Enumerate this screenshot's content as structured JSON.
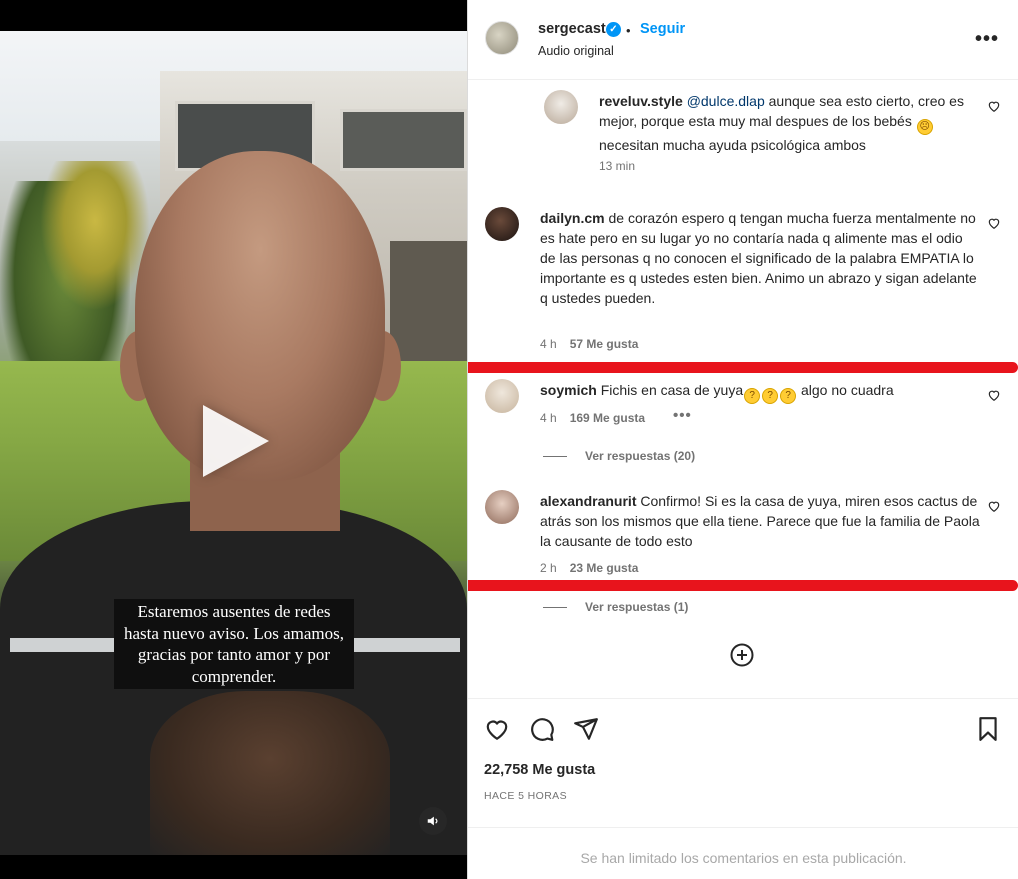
{
  "video": {
    "caption": "Estaremos ausentes de redes hasta nuevo aviso. Los amamos, gracias por tanto amor y por comprender.",
    "play_icon": "play-icon",
    "mute_icon": "speaker-icon"
  },
  "header": {
    "username": "sergecast",
    "verified_icon": "verified-badge-icon",
    "separator": "•",
    "follow_label": "Seguir",
    "subtitle": "Audio original",
    "more_icon": "more-options-icon"
  },
  "comments": [
    {
      "username": "reveluv.style",
      "mention": "@dulce.dlap",
      "text": " aunque sea esto cierto, creo es mejor, porque esta muy mal despues de los bebés",
      "text_emoji": "😦",
      "text_tail": " necesitan mucha ayuda psicológica ambos",
      "time": "13 min"
    },
    {
      "username": "dailyn.cm",
      "text": "de corazón espero q tengan mucha fuerza mentalmente no es hate pero en su lugar yo no contaría nada q alimente mas el odio de las personas q no conocen el significado de la palabra EMPATIA lo importante es q ustedes esten bien. Animo un abrazo y sigan adelante q ustedes pueden.",
      "time": "4 h",
      "likes": "57 Me gusta"
    },
    {
      "username": "soymich",
      "text": "Fichis en casa de yuya",
      "emojis": "🤔🤔🤔",
      "text_tail": "algo no cuadra",
      "time": "4 h",
      "likes": "169 Me gusta",
      "dots": "•••",
      "replies": "Ver respuestas (20)"
    },
    {
      "username": "alexandranurit",
      "text": "Confirmo! Si es la casa de yuya, miren esos cactus de atrás son los mismos que ella tiene. Parece que fue la familia de Paola la causante de todo esto",
      "time": "2 h",
      "likes": "23 Me gusta",
      "replies": "Ver respuestas (1)"
    }
  ],
  "add_comments_icon": "plus-circle-icon",
  "actions": {
    "like_icon": "heart-icon",
    "comment_icon": "comment-icon",
    "share_icon": "share-icon",
    "save_icon": "bookmark-icon",
    "likes": "22,758 Me gusta",
    "time_ago": "HACE 5 HORAS",
    "limited_notice": "Se han limitado los comentarios en esta publicación."
  },
  "colors": {
    "accent": "#0095f6",
    "annotation_red": "#e8141c"
  }
}
